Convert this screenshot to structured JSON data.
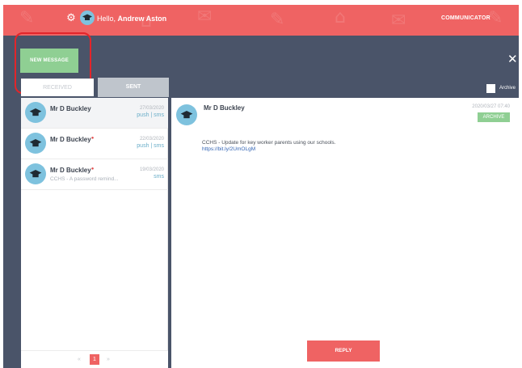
{
  "header": {
    "greeting": "Hello, ",
    "user_name": "Andrew Aston",
    "app_name": "COMMUNICATOR",
    "settings_icon": "gear-icon",
    "avatar_icon": "graduation-cap-icon"
  },
  "toolbar": {
    "new_message_label": "NEW MESSAGE",
    "close_icon": "close-icon"
  },
  "tabs": [
    {
      "label": "RECEIVED",
      "active": true
    },
    {
      "label": "SENT",
      "active": false
    }
  ],
  "archive_filter": {
    "label": "Archive",
    "checked": false
  },
  "messages": [
    {
      "sender": "Mr D Buckley",
      "unread": false,
      "preview": "",
      "date": "27/03/2020",
      "channels": "push | sms"
    },
    {
      "sender": "Mr D Buckley",
      "unread": true,
      "preview": "",
      "date": "22/03/2020",
      "channels": "push | sms"
    },
    {
      "sender": "Mr D Buckley",
      "unread": true,
      "preview": "CCHS - A password remind...",
      "date": "19/03/2020",
      "channels": "sms"
    }
  ],
  "pagination": {
    "prev": "«",
    "current": "1",
    "next": "»"
  },
  "detail": {
    "sender": "Mr D Buckley",
    "date": "2020/03/27 07:40",
    "archive_label": "ARCHIVE",
    "body": "CCHS - Update for key worker parents using our schools.",
    "link": "https://bit.ly/2UmOLgM",
    "reply_label": "REPLY"
  },
  "colors": {
    "topbar": "#ef6363",
    "panel": "#4a5469",
    "accent_green": "#8fcf93",
    "avatar_blue": "#7ec2de",
    "highlight_red": "#e3252a"
  }
}
